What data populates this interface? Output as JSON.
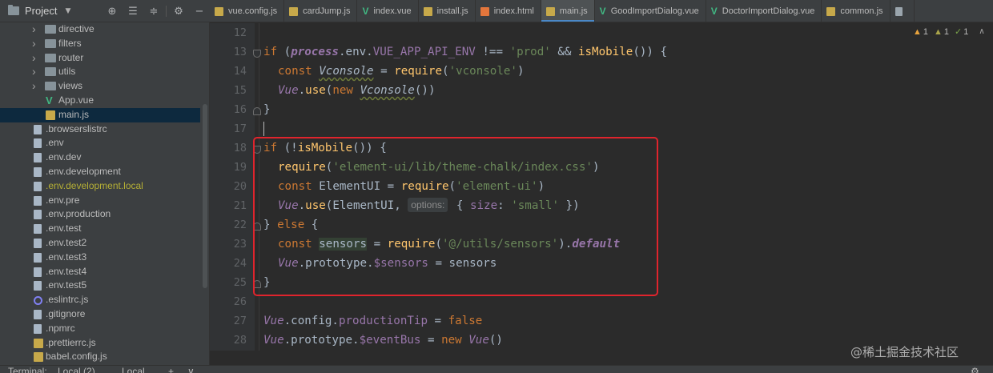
{
  "project_panel": {
    "title": "Project",
    "tools": [
      "target-icon",
      "collapse-icon",
      "expand-icon",
      "gear-icon"
    ],
    "tree": [
      {
        "label": "directive",
        "type": "folder"
      },
      {
        "label": "filters",
        "type": "folder"
      },
      {
        "label": "router",
        "type": "folder"
      },
      {
        "label": "utils",
        "type": "folder"
      },
      {
        "label": "views",
        "type": "folder"
      },
      {
        "label": "App.vue",
        "type": "vue"
      },
      {
        "label": "main.js",
        "type": "js",
        "selected": true
      },
      {
        "label": ".browserslistrc",
        "type": "file"
      },
      {
        "label": ".env",
        "type": "file"
      },
      {
        "label": ".env.dev",
        "type": "file"
      },
      {
        "label": ".env.development",
        "type": "file"
      },
      {
        "label": ".env.development.local",
        "type": "file",
        "ignored": true
      },
      {
        "label": ".env.pre",
        "type": "file"
      },
      {
        "label": ".env.production",
        "type": "file"
      },
      {
        "label": ".env.test",
        "type": "file"
      },
      {
        "label": ".env.test2",
        "type": "file"
      },
      {
        "label": ".env.test3",
        "type": "file"
      },
      {
        "label": ".env.test4",
        "type": "file"
      },
      {
        "label": ".env.test5",
        "type": "file"
      },
      {
        "label": ".eslintrc.js",
        "type": "eslint"
      },
      {
        "label": ".gitignore",
        "type": "file"
      },
      {
        "label": ".npmrc",
        "type": "file"
      },
      {
        "label": ".prettierrc.js",
        "type": "js"
      },
      {
        "label": "babel.config.js",
        "type": "js"
      }
    ]
  },
  "tabs": [
    {
      "label": "vue.config.js",
      "type": "js"
    },
    {
      "label": "cardJump.js",
      "type": "js"
    },
    {
      "label": "index.vue",
      "type": "vue"
    },
    {
      "label": "install.js",
      "type": "js"
    },
    {
      "label": "index.html",
      "type": "html"
    },
    {
      "label": "main.js",
      "type": "js",
      "active": true
    },
    {
      "label": "GoodImportDialog.vue",
      "type": "vue"
    },
    {
      "label": "DoctorImportDialog.vue",
      "type": "vue"
    },
    {
      "label": "common.js",
      "type": "js"
    },
    {
      "label": "",
      "type": "gen"
    }
  ],
  "inspections": {
    "warnings": "1",
    "weak_warnings": "1",
    "typos": "1"
  },
  "editor": {
    "line_numbers": [
      "12",
      "13",
      "14",
      "15",
      "16",
      "17",
      "18",
      "19",
      "20",
      "21",
      "22",
      "23",
      "24",
      "25",
      "26",
      "27",
      "28"
    ],
    "code": {
      "l13_if": "if",
      "l13_open": " (",
      "l13_process": "process",
      "l13_env": ".env.",
      "l13_var": "VUE_APP_API_ENV",
      "l13_neq": " !== ",
      "l13_prod": "'prod'",
      "l13_and": " && ",
      "l13_ismobile": "isMobile",
      "l13_end": "()) {",
      "l14_const": "const ",
      "l14_vconsole": "Vconsole",
      "l14_eq": " = ",
      "l14_require": "require",
      "l14_p1": "(",
      "l14_str": "'vconsole'",
      "l14_p2": ")",
      "l15_vue": "Vue",
      "l15_dot": ".",
      "l15_use": "use",
      "l15_p1": "(",
      "l15_new": "new ",
      "l15_vconsole": "Vconsole",
      "l15_p2": "())",
      "l16": "}",
      "l18_if": "if",
      "l18_open": " (!",
      "l18_ismobile": "isMobile",
      "l18_end": "()) {",
      "l19_require": "require",
      "l19_p1": "(",
      "l19_str": "'element-ui/lib/theme-chalk/index.css'",
      "l19_p2": ")",
      "l20_const": "const ",
      "l20_name": "ElementUI",
      "l20_eq": " = ",
      "l20_require": "require",
      "l20_p1": "(",
      "l20_str": "'element-ui'",
      "l20_p2": ")",
      "l21_vue": "Vue",
      "l21_dot": ".",
      "l21_use": "use",
      "l21_args": "(ElementUI, ",
      "l21_hint": "options:",
      "l21_obj1": " { ",
      "l21_size": "size",
      "l21_colon": ": ",
      "l21_small": "'small'",
      "l21_obj2": " })",
      "l22_close": "} ",
      "l22_else": "else",
      "l22_brace": " {",
      "l23_const": "const ",
      "l23_sensors": "sensors",
      "l23_eq": " = ",
      "l23_require": "require",
      "l23_p1": "(",
      "l23_str": "'@/utils/sensors'",
      "l23_p2": ").",
      "l23_default": "default",
      "l24_vue": "Vue",
      "l24_proto": ".prototype.",
      "l24_prop": "$sensors",
      "l24_rest": " = sensors",
      "l25": "}",
      "l27_vue": "Vue",
      "l27_cfg": ".config.",
      "l27_prop": "productionTip",
      "l27_eq": " = ",
      "l27_false": "false",
      "l28_vue": "Vue",
      "l28_proto": ".prototype.",
      "l28_prop": "$eventBus",
      "l28_eq": " = ",
      "l28_new": "new ",
      "l28_cls": "Vue",
      "l28_end": "()"
    }
  },
  "bottom_bar": {
    "terminal_label": "Terminal:",
    "tab1": "Local (2)",
    "tab2": "Local",
    "add": "+",
    "more": "∨"
  },
  "watermark": "@稀土掘金技术社区",
  "colors": {
    "keyword": "#cc7832",
    "function": "#ffc66d",
    "string": "#6a8759",
    "global": "#9876aa",
    "highlight_box": "#e0242d",
    "active_tab_underline": "#4a88c7"
  }
}
